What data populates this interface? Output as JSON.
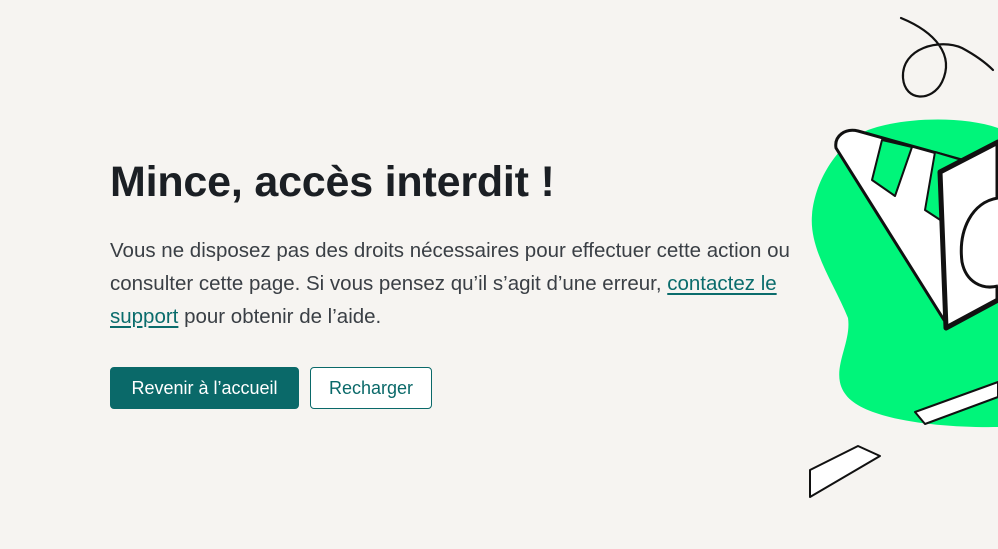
{
  "error": {
    "title": "Mince, accès interdit !",
    "message_before_link": "Vous ne disposez pas des droits nécessaires pour effectuer cette action ou consulter cette page. Si vous pensez qu’il s’agit d’une erreur, ",
    "support_link_label": "contactez le support",
    "message_after_link": " pour obtenir de l’aide."
  },
  "actions": {
    "home_label": "Revenir à l’accueil",
    "reload_label": "Recharger"
  },
  "colors": {
    "background": "#f6f4f1",
    "accent": "#0a6969",
    "illustration_green": "#00f57a",
    "text": "#1b1f24"
  },
  "illustration": {
    "icon": "traffic-cone-icon"
  }
}
